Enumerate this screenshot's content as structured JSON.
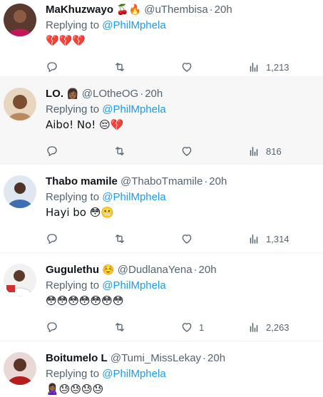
{
  "tweets": [
    {
      "name": "MaKhuzwayo",
      "name_emoji": "🍒🔥",
      "handle": "@uThembisa",
      "time": "20h",
      "replying_prefix": "Replying to ",
      "replying_to": "@PhilMphela",
      "text": "💔💔💔",
      "reply_count": "",
      "retweet_count": "",
      "like_count": "",
      "views": "1,213",
      "highlighted": false,
      "avatar_color": "#c2185b"
    },
    {
      "name": "LO.",
      "name_emoji": "👩🏾",
      "handle": "@LOtheOG",
      "time": "20h",
      "replying_prefix": "Replying to ",
      "replying_to": "@PhilMphela",
      "text": "Aibo! No! 😔💔",
      "reply_count": "",
      "retweet_count": "",
      "like_count": "",
      "views": "816",
      "highlighted": true,
      "avatar_color": "#d9b48f"
    },
    {
      "name": "Thabo mamile",
      "name_emoji": "",
      "handle": "@ThaboTmamile",
      "time": "20h",
      "replying_prefix": "Replying to ",
      "replying_to": "@PhilMphela",
      "text": "Hayi bo 😳😬",
      "reply_count": "",
      "retweet_count": "",
      "like_count": "",
      "views": "1,314",
      "highlighted": false,
      "avatar_color": "#8aa4c8"
    },
    {
      "name": "Gugulethu",
      "name_emoji": "☺️",
      "handle": "@DudlanaYena",
      "time": "20h",
      "replying_prefix": "Replying to ",
      "replying_to": "@PhilMphela",
      "text": "😳😳😳😳😳😳😳",
      "reply_count": "",
      "retweet_count": "",
      "like_count": "1",
      "views": "2,263",
      "highlighted": false,
      "avatar_color": "#e0e0e0"
    },
    {
      "name": "Boitumelo L",
      "name_emoji": "",
      "handle": "@Tumi_MissLekay",
      "time": "20h",
      "replying_prefix": "Replying to ",
      "replying_to": "@PhilMphela",
      "text": "🙎🏾‍♀️😓😓😓😓",
      "reply_count": "",
      "retweet_count": "",
      "like_count": "",
      "views": "",
      "highlighted": false,
      "avatar_color": "#b71c1c"
    }
  ],
  "icons": {
    "reply": "reply-icon",
    "retweet": "retweet-icon",
    "like": "heart-icon",
    "views": "views-chart-icon"
  },
  "colors": {
    "link": "#1d9bf0",
    "secondary_text": "#536471",
    "highlight_bg": "#f7f7f7"
  }
}
